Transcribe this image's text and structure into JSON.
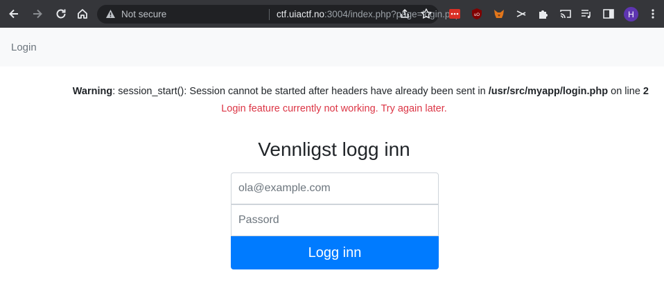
{
  "browser": {
    "security_label": "Not secure",
    "url_host": "ctf.uiactf.no",
    "url_rest": ":3004/index.php?page=login.php",
    "profile_initial": "H",
    "accent_colors": {
      "toolbar_bg": "#35363a",
      "omnibox_bg": "#202124",
      "avatar": "#5e35b1"
    }
  },
  "navbar": {
    "brand": "Login"
  },
  "warning": {
    "label": "Warning",
    "message": ": session_start(): Session cannot be started after headers have already been sent in ",
    "file": "/usr/src/myapp/login.php",
    "on_line": " on line ",
    "line_number": "2"
  },
  "error": {
    "message": "Login feature currently not working. Try again later.",
    "color": "#dc3545"
  },
  "form": {
    "heading": "Vennligst logg inn",
    "email_placeholder": "ola@example.com",
    "email_value": "",
    "password_placeholder": "Passord",
    "password_value": "",
    "submit_label": "Logg inn",
    "submit_color": "#007bff"
  }
}
